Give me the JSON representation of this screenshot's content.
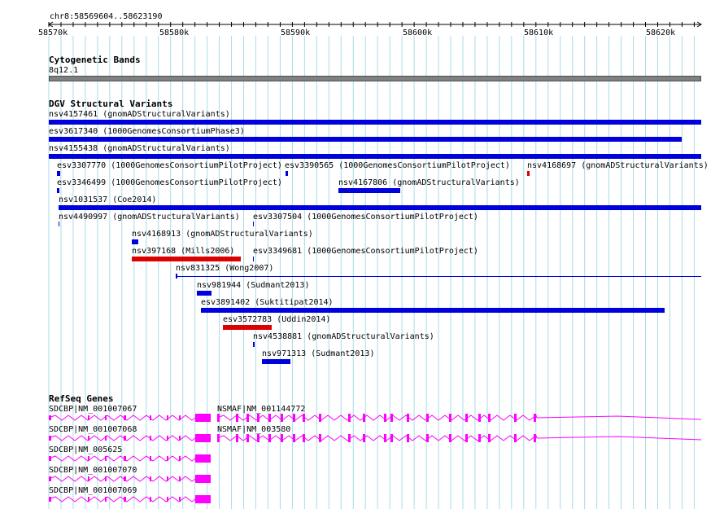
{
  "ruler": {
    "region": "chr8:58569604..58623190",
    "ticks": [
      "58570k",
      "58580k",
      "58590k",
      "58600k",
      "58610k",
      "58620k"
    ]
  },
  "tracks": {
    "cytobands": {
      "title": "Cytogenetic Bands",
      "band": "8q12.1"
    },
    "dgv": {
      "title": "DGV Structural Variants",
      "features": [
        {
          "label": "nsv4157461 (gnomADStructuralVariants)",
          "color": "#0000dd"
        },
        {
          "label": "esv3617340 (1000GenomesConsortiumPhase3)",
          "color": "#0000dd"
        },
        {
          "label": "nsv4155438 (gnomADStructuralVariants)",
          "color": "#0000dd"
        },
        {
          "label": "esv3307770 (1000GenomesConsortiumPilotProject)",
          "color": "#0000dd"
        },
        {
          "label": "esv3390565 (1000GenomesConsortiumPilotProject)",
          "color": "#0000dd"
        },
        {
          "label": "nsv4168697 (gnomADStructuralVariants)",
          "color": "#dd0000"
        },
        {
          "label": "esv3346499 (1000GenomesConsortiumPilotProject)",
          "color": "#0000dd"
        },
        {
          "label": "nsv4167806 (gnomADStructuralVariants)",
          "color": "#0000dd"
        },
        {
          "label": "nsv1031537 (Coe2014)",
          "color": "#0000dd"
        },
        {
          "label": "nsv4490997 (gnomADStructuralVariants)",
          "color": "#0000dd"
        },
        {
          "label": "esv3307504 (1000GenomesConsortiumPilotProject)",
          "color": "#0000dd"
        },
        {
          "label": "nsv4168913 (gnomADStructuralVariants)",
          "color": "#0000dd"
        },
        {
          "label": "nsv397168 (Mills2006)",
          "color": "#dd0000"
        },
        {
          "label": "esv3349681 (1000GenomesConsortiumPilotProject)",
          "color": "#0000dd"
        },
        {
          "label": "nsv831325 (Wong2007)",
          "color": "#0000dd"
        },
        {
          "label": "nsv981944 (Sudmant2013)",
          "color": "#0000dd"
        },
        {
          "label": "esv3891402 (Suktitipat2014)",
          "color": "#0000dd"
        },
        {
          "label": "esv3572783 (Uddin2014)",
          "color": "#dd0000"
        },
        {
          "label": "nsv4538881 (gnomADStructuralVariants)",
          "color": "#0000dd"
        },
        {
          "label": "nsv971313 (Sudmant2013)",
          "color": "#0000dd"
        }
      ]
    },
    "refseq": {
      "title": "RefSeq Genes",
      "genes": [
        {
          "label": "SDCBP|NM_001007067"
        },
        {
          "label": "NSMAF|NM_001144772"
        },
        {
          "label": "SDCBP|NM_001007068"
        },
        {
          "label": "NSMAF|NM_003580"
        },
        {
          "label": "SDCBP|NM_005625"
        },
        {
          "label": "SDCBP|NM_001007070"
        },
        {
          "label": "SDCBP|NM_001007069"
        }
      ]
    }
  },
  "colors": {
    "grid": "#a8dce8",
    "variant_blue": "#0000dd",
    "variant_red": "#dd0000",
    "gene": "#ff00ff",
    "cytoband": "#808080"
  }
}
